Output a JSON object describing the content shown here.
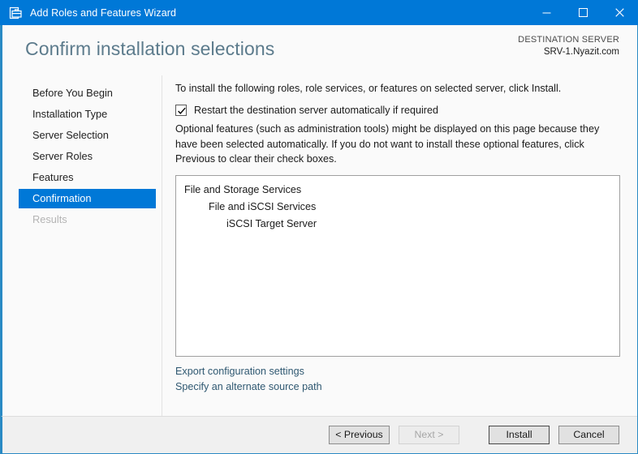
{
  "window": {
    "title": "Add Roles and Features Wizard",
    "icon": "wizard-toolbox-icon",
    "accent_color": "#0078d7",
    "controls": {
      "minimize": "minimize-icon",
      "maximize": "maximize-icon",
      "close": "close-icon"
    }
  },
  "header": {
    "title": "Confirm installation selections",
    "destination_label": "DESTINATION SERVER",
    "destination_value": "SRV-1.Nyazit.com"
  },
  "sidebar": {
    "items": [
      {
        "label": "Before You Begin",
        "state": "normal"
      },
      {
        "label": "Installation Type",
        "state": "normal"
      },
      {
        "label": "Server Selection",
        "state": "normal"
      },
      {
        "label": "Server Roles",
        "state": "normal"
      },
      {
        "label": "Features",
        "state": "normal"
      },
      {
        "label": "Confirmation",
        "state": "selected"
      },
      {
        "label": "Results",
        "state": "disabled"
      }
    ]
  },
  "main": {
    "intro": "To install the following roles, role services, or features on selected server, click Install.",
    "restart_checkbox": {
      "label": "Restart the destination server automatically if required",
      "checked": true
    },
    "optional_paragraph": "Optional features (such as administration tools) might be displayed on this page because they have been selected automatically. If you do not want to install these optional features, click Previous to clear their check boxes.",
    "selections": [
      {
        "label": "File and Storage Services",
        "level": 0
      },
      {
        "label": "File and iSCSI Services",
        "level": 1
      },
      {
        "label": "iSCSI Target Server",
        "level": 2
      }
    ],
    "links": [
      {
        "label": "Export configuration settings"
      },
      {
        "label": "Specify an alternate source path"
      }
    ]
  },
  "footer": {
    "buttons": [
      {
        "label": "< Previous",
        "state": "normal"
      },
      {
        "label": "Next >",
        "state": "disabled"
      },
      {
        "label": "Install",
        "state": "default"
      },
      {
        "label": "Cancel",
        "state": "normal"
      }
    ]
  }
}
